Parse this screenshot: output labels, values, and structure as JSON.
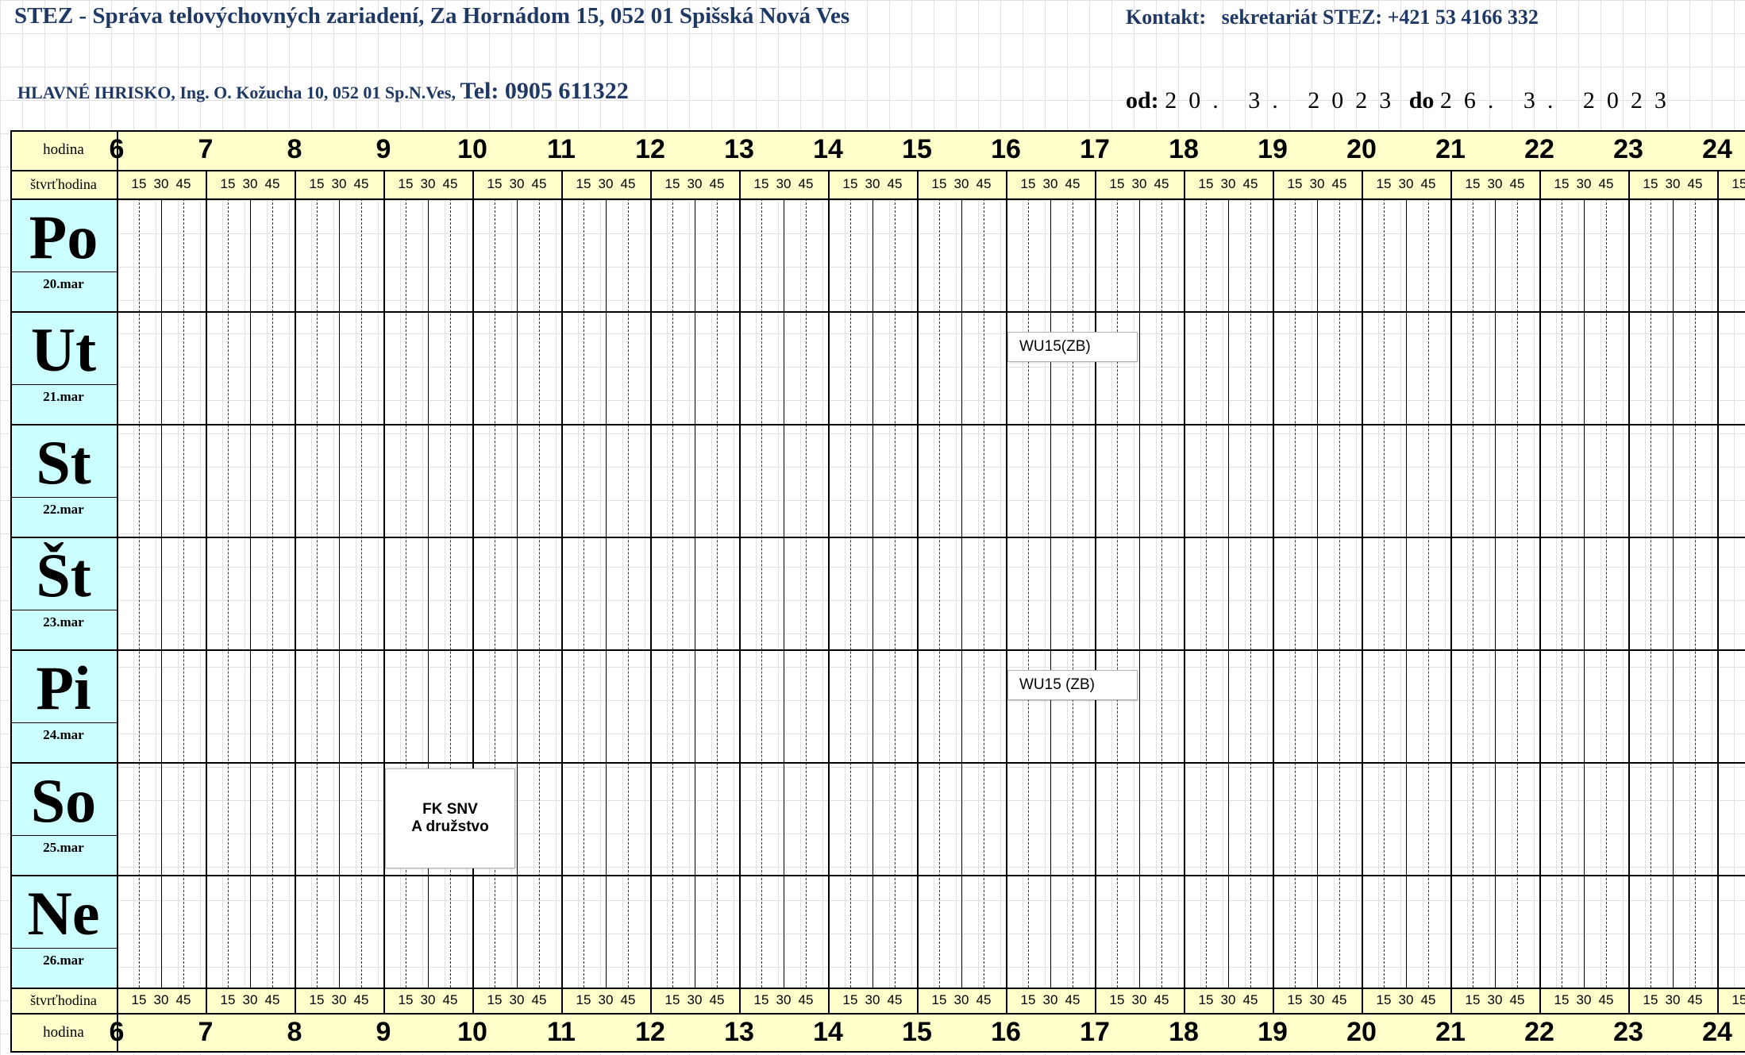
{
  "header": {
    "title": "STEZ - Správa telovýchovných zariadení, Za Hornádom 15, 052 01 Spišská Nová Ves",
    "contact_label": "Kontakt:",
    "contact_value": "sekretariát STEZ: +421 53 4166 332",
    "venue": "HLAVNÉ IHRISKO, Ing. O. Kožucha 10, 052 01 Sp.N.Ves,",
    "tel": "Tel: 0905 611322",
    "from_label": "od:",
    "from_date": "20. 3. 2023",
    "to_label": "do",
    "to_date": "26. 3. 2023"
  },
  "table": {
    "hour_label": "hodina",
    "quarter_label": "štvrťhodina",
    "hours": [
      "6",
      "7",
      "8",
      "9",
      "10",
      "11",
      "12",
      "13",
      "14",
      "15",
      "16",
      "17",
      "18",
      "19",
      "20",
      "21",
      "22",
      "23",
      "24"
    ],
    "quarters": [
      "15",
      "30",
      "45"
    ],
    "days": [
      {
        "name": "Po",
        "date": "20.mar"
      },
      {
        "name": "Ut",
        "date": "21.mar"
      },
      {
        "name": "St",
        "date": "22.mar"
      },
      {
        "name": "Št",
        "date": "23.mar"
      },
      {
        "name": "Pi",
        "date": "24.mar"
      },
      {
        "name": "So",
        "date": "25.mar"
      },
      {
        "name": "Ne",
        "date": "26.mar"
      }
    ]
  },
  "events": [
    {
      "day": 1,
      "start": 16.0,
      "end": 17.5,
      "lines": [
        "WU15(ZB)"
      ],
      "style": "left"
    },
    {
      "day": 4,
      "start": 16.0,
      "end": 17.5,
      "lines": [
        "WU15 (ZB)"
      ],
      "style": "left"
    },
    {
      "day": 5,
      "start": 9.0,
      "end": 10.5,
      "lines": [
        "FK SNV",
        "A družstvo"
      ],
      "style": "center"
    }
  ],
  "colors": {
    "header_text": "#1f3864",
    "header_band": "#ffffcc",
    "day_band": "#ccffff"
  }
}
